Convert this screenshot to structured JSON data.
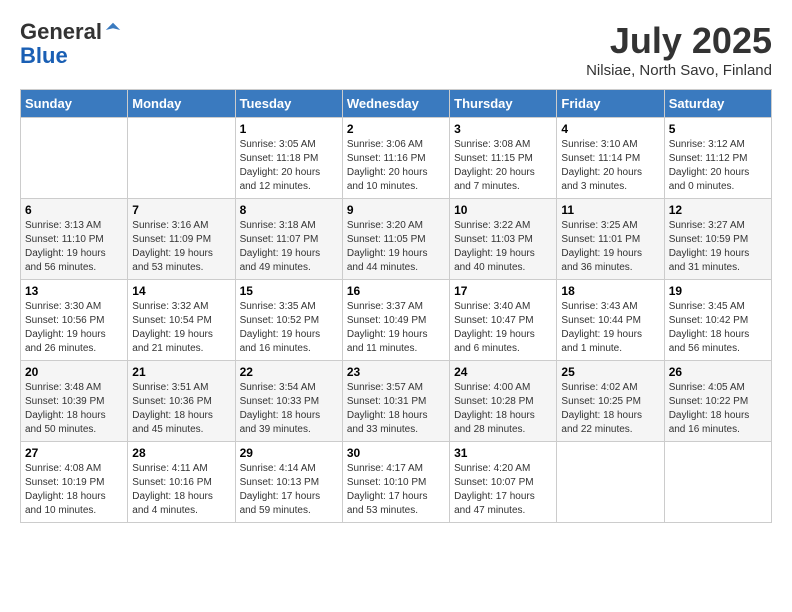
{
  "header": {
    "logo_general": "General",
    "logo_blue": "Blue",
    "month_title": "July 2025",
    "location": "Nilsiae, North Savo, Finland"
  },
  "weekdays": [
    "Sunday",
    "Monday",
    "Tuesday",
    "Wednesday",
    "Thursday",
    "Friday",
    "Saturday"
  ],
  "weeks": [
    [
      {
        "day": "",
        "info": ""
      },
      {
        "day": "",
        "info": ""
      },
      {
        "day": "1",
        "info": "Sunrise: 3:05 AM\nSunset: 11:18 PM\nDaylight: 20 hours and 12 minutes."
      },
      {
        "day": "2",
        "info": "Sunrise: 3:06 AM\nSunset: 11:16 PM\nDaylight: 20 hours and 10 minutes."
      },
      {
        "day": "3",
        "info": "Sunrise: 3:08 AM\nSunset: 11:15 PM\nDaylight: 20 hours and 7 minutes."
      },
      {
        "day": "4",
        "info": "Sunrise: 3:10 AM\nSunset: 11:14 PM\nDaylight: 20 hours and 3 minutes."
      },
      {
        "day": "5",
        "info": "Sunrise: 3:12 AM\nSunset: 11:12 PM\nDaylight: 20 hours and 0 minutes."
      }
    ],
    [
      {
        "day": "6",
        "info": "Sunrise: 3:13 AM\nSunset: 11:10 PM\nDaylight: 19 hours and 56 minutes."
      },
      {
        "day": "7",
        "info": "Sunrise: 3:16 AM\nSunset: 11:09 PM\nDaylight: 19 hours and 53 minutes."
      },
      {
        "day": "8",
        "info": "Sunrise: 3:18 AM\nSunset: 11:07 PM\nDaylight: 19 hours and 49 minutes."
      },
      {
        "day": "9",
        "info": "Sunrise: 3:20 AM\nSunset: 11:05 PM\nDaylight: 19 hours and 44 minutes."
      },
      {
        "day": "10",
        "info": "Sunrise: 3:22 AM\nSunset: 11:03 PM\nDaylight: 19 hours and 40 minutes."
      },
      {
        "day": "11",
        "info": "Sunrise: 3:25 AM\nSunset: 11:01 PM\nDaylight: 19 hours and 36 minutes."
      },
      {
        "day": "12",
        "info": "Sunrise: 3:27 AM\nSunset: 10:59 PM\nDaylight: 19 hours and 31 minutes."
      }
    ],
    [
      {
        "day": "13",
        "info": "Sunrise: 3:30 AM\nSunset: 10:56 PM\nDaylight: 19 hours and 26 minutes."
      },
      {
        "day": "14",
        "info": "Sunrise: 3:32 AM\nSunset: 10:54 PM\nDaylight: 19 hours and 21 minutes."
      },
      {
        "day": "15",
        "info": "Sunrise: 3:35 AM\nSunset: 10:52 PM\nDaylight: 19 hours and 16 minutes."
      },
      {
        "day": "16",
        "info": "Sunrise: 3:37 AM\nSunset: 10:49 PM\nDaylight: 19 hours and 11 minutes."
      },
      {
        "day": "17",
        "info": "Sunrise: 3:40 AM\nSunset: 10:47 PM\nDaylight: 19 hours and 6 minutes."
      },
      {
        "day": "18",
        "info": "Sunrise: 3:43 AM\nSunset: 10:44 PM\nDaylight: 19 hours and 1 minute."
      },
      {
        "day": "19",
        "info": "Sunrise: 3:45 AM\nSunset: 10:42 PM\nDaylight: 18 hours and 56 minutes."
      }
    ],
    [
      {
        "day": "20",
        "info": "Sunrise: 3:48 AM\nSunset: 10:39 PM\nDaylight: 18 hours and 50 minutes."
      },
      {
        "day": "21",
        "info": "Sunrise: 3:51 AM\nSunset: 10:36 PM\nDaylight: 18 hours and 45 minutes."
      },
      {
        "day": "22",
        "info": "Sunrise: 3:54 AM\nSunset: 10:33 PM\nDaylight: 18 hours and 39 minutes."
      },
      {
        "day": "23",
        "info": "Sunrise: 3:57 AM\nSunset: 10:31 PM\nDaylight: 18 hours and 33 minutes."
      },
      {
        "day": "24",
        "info": "Sunrise: 4:00 AM\nSunset: 10:28 PM\nDaylight: 18 hours and 28 minutes."
      },
      {
        "day": "25",
        "info": "Sunrise: 4:02 AM\nSunset: 10:25 PM\nDaylight: 18 hours and 22 minutes."
      },
      {
        "day": "26",
        "info": "Sunrise: 4:05 AM\nSunset: 10:22 PM\nDaylight: 18 hours and 16 minutes."
      }
    ],
    [
      {
        "day": "27",
        "info": "Sunrise: 4:08 AM\nSunset: 10:19 PM\nDaylight: 18 hours and 10 minutes."
      },
      {
        "day": "28",
        "info": "Sunrise: 4:11 AM\nSunset: 10:16 PM\nDaylight: 18 hours and 4 minutes."
      },
      {
        "day": "29",
        "info": "Sunrise: 4:14 AM\nSunset: 10:13 PM\nDaylight: 17 hours and 59 minutes."
      },
      {
        "day": "30",
        "info": "Sunrise: 4:17 AM\nSunset: 10:10 PM\nDaylight: 17 hours and 53 minutes."
      },
      {
        "day": "31",
        "info": "Sunrise: 4:20 AM\nSunset: 10:07 PM\nDaylight: 17 hours and 47 minutes."
      },
      {
        "day": "",
        "info": ""
      },
      {
        "day": "",
        "info": ""
      }
    ]
  ]
}
